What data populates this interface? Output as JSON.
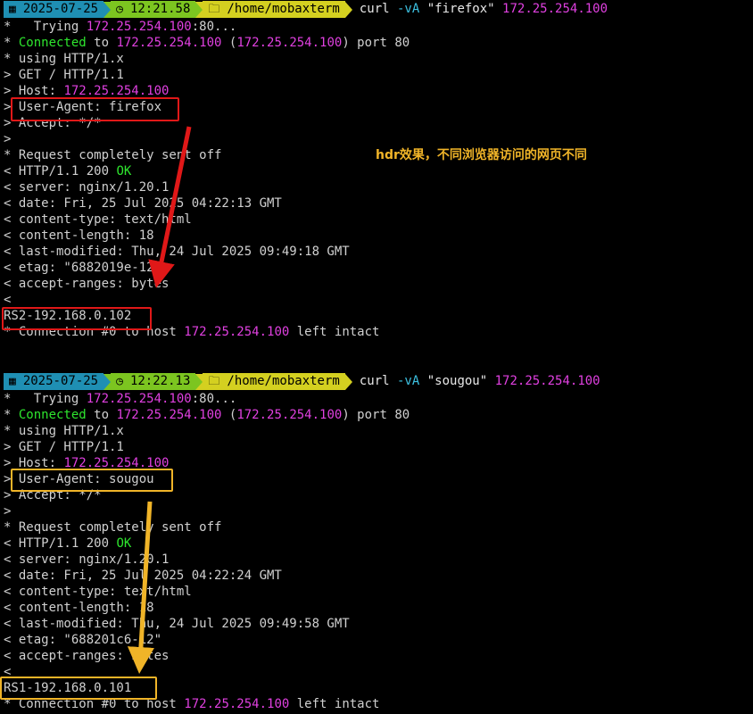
{
  "session1": {
    "prompt": {
      "date": "2025-07-25",
      "time": "12:21.58",
      "path": "/home/mobaxterm"
    },
    "command": {
      "prog": "curl",
      "flag": "-vA",
      "agent": "\"firefox\"",
      "host": "172.25.254.100"
    },
    "trying": {
      "pre": "*   Trying ",
      "ip": "172.25.254.100",
      "post": ":80..."
    },
    "connected": {
      "pre": "* ",
      "word": "Connected",
      "to": " to ",
      "ip": "172.25.254.100",
      "paren_open": " (",
      "ip2": "172.25.254.100",
      "paren_close": ") port 80"
    },
    "using": "* using HTTP/1.x",
    "get": "> GET / HTTP/1.1",
    "host_line": {
      "pre": "> Host: ",
      "ip": "172.25.254.100"
    },
    "ua_prefix": ">",
    "ua": "User-Agent: firefox",
    "accept": "> Accept: */*",
    "gt": ">",
    "sent": "* Request completely sent off",
    "status": {
      "pre": "< HTTP/1.1 200 ",
      "ok": "OK"
    },
    "server": "< server: nginx/1.20.1",
    "date": "< date: Fri, 25 Jul 2025 04:22:13 GMT",
    "ctype": "< content-type: text/html",
    "clen": "< content-length: 18",
    "lastmod": "< last-modified: Thu, 24 Jul 2025 09:49:18 GMT",
    "etag": "< etag: \"6882019e-12\"",
    "ranges": "< accept-ranges: bytes",
    "lt": "<",
    "body": "RS2-192.168.0.102",
    "closing": {
      "pre": "* Connection #0 to host ",
      "ip": "172.25.254.100",
      "post": " left intact"
    }
  },
  "session2": {
    "prompt": {
      "date": "2025-07-25",
      "time": "12:22.13",
      "path": "/home/mobaxterm"
    },
    "command": {
      "prog": "curl",
      "flag": "-vA",
      "agent": "\"sougou\"",
      "host": "172.25.254.100"
    },
    "trying": {
      "pre": "*   Trying ",
      "ip": "172.25.254.100",
      "post": ":80..."
    },
    "connected": {
      "pre": "* ",
      "word": "Connected",
      "to": " to ",
      "ip": "172.25.254.100",
      "paren_open": " (",
      "ip2": "172.25.254.100",
      "paren_close": ") port 80"
    },
    "using": "* using HTTP/1.x",
    "get": "> GET / HTTP/1.1",
    "host_line": {
      "pre": "> Host: ",
      "ip": "172.25.254.100"
    },
    "ua_prefix": ">",
    "ua": "User-Agent: sougou",
    "accept": "> Accept: */*",
    "gt": ">",
    "sent": "* Request completely sent off",
    "status": {
      "pre": "< HTTP/1.1 200 ",
      "ok": "OK"
    },
    "server": "< server: nginx/1.20.1",
    "date": "< date: Fri, 25 Jul 2025 04:22:24 GMT",
    "ctype": "< content-type: text/html",
    "clen": "< content-length: 18",
    "lastmod": "< last-modified: Thu, 24 Jul 2025 09:49:58 GMT",
    "etag": "< etag: \"688201c6-12\"",
    "ranges": "< accept-ranges: bytes",
    "lt": "<",
    "body": "RS1-192.168.0.101",
    "closing": {
      "pre": "* Connection #0 to host ",
      "ip": "172.25.254.100",
      "post": " left intact"
    }
  },
  "annotation": {
    "note": "hdr效果，不同浏览器访问的网页不同",
    "red": "#e01818",
    "yellow": "#f0b428"
  }
}
